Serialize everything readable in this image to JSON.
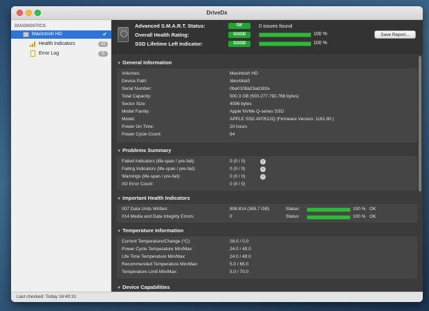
{
  "window": {
    "title": "DriveDx"
  },
  "sidebar": {
    "header": "DIAGNOSTICS",
    "items": [
      {
        "label": "Macintosh HD",
        "icon": "disk-icon",
        "selected": true
      },
      {
        "label": "Health Indicators",
        "icon": "health-bars-icon",
        "badge": "15"
      },
      {
        "label": "Error Log",
        "icon": "log-document-icon",
        "badge": "0"
      }
    ]
  },
  "status_bar": {
    "text": "Last checked: Today 16:40:31"
  },
  "summary": {
    "smart_label": "Advanced S.M.A.R.T. Status:",
    "smart_badge": "OK",
    "smart_text": "0 issues found",
    "health_label": "Overall Health Rating:",
    "health_badge": "GOOD",
    "health_percent": 100,
    "health_percent_text": "100 %",
    "lifetime_label": "SSD Lifetime Left Indicator:",
    "lifetime_badge": "GOOD",
    "lifetime_percent": 100,
    "lifetime_percent_text": "100 %",
    "save_button": "Save Report...",
    "accent_color": "#22c22f"
  },
  "general": {
    "title": "General Information",
    "rows": [
      {
        "k": "Volumes:",
        "v": "Macintosh HD"
      },
      {
        "k": "Device Path:",
        "v": "/dev/disk0"
      },
      {
        "k": "Serial Number:",
        "v": "0ba0108a23ad182e"
      },
      {
        "k": "Total Capacity:",
        "v": "500.3 GB (500.277.792.768 bytes)"
      },
      {
        "k": "Sector Size:",
        "v": "4096 bytes"
      },
      {
        "k": "Model Family:",
        "v": "Apple NVMe Q-series SSD"
      },
      {
        "k": "Model:",
        "v": "APPLE SSD AP0512Q  (Firmware Version: 1161.80.)"
      },
      {
        "k": "Power On Time:",
        "v": "20 hours"
      },
      {
        "k": "Power Cycle Count:",
        "v": "64"
      }
    ]
  },
  "problems": {
    "title": "Problems Summary",
    "rows": [
      {
        "k": "Failed Indicators (life-span / pre-fail):",
        "v": "0 (0 / 0)"
      },
      {
        "k": "Failing Indicators (life-span / pre-fail):",
        "v": "0 (0 / 0)"
      },
      {
        "k": "Warnings (life-span / pre-fail):",
        "v": "0 (0 / 0)"
      },
      {
        "k": "I/O Error Count:",
        "v": "0 (0 / 0)"
      }
    ]
  },
  "health_indicators": {
    "title": "Important Health Indicators",
    "status_label": "Status:",
    "rows": [
      {
        "k": "007  Data Units Written:",
        "v": "808.814 (385.7 GB)",
        "percent": 100,
        "pct_text": "100 %",
        "status": "OK"
      },
      {
        "k": "014  Media and Data Integrity Errors:",
        "v": "0",
        "percent": 100,
        "pct_text": "100 %",
        "status": "OK"
      }
    ]
  },
  "temperature": {
    "title": "Temperature Information",
    "rows": [
      {
        "k": "Current Temperature/Change (°C):",
        "v": "28.0 / 0.0"
      },
      {
        "k": "Power Cycle Temperature Min/Max:",
        "v": "24.0 / 49.0"
      },
      {
        "k": "Life Time Temperature Min/Max:",
        "v": "24.0 / 49.0"
      },
      {
        "k": "Recommended Temperature Min/Max:",
        "v": "5.0   / 65.0"
      },
      {
        "k": "Temperature Limit Min/Max:",
        "v": "5.0   / 70.0"
      }
    ]
  },
  "capabilities": {
    "title": "Device Capabilities"
  }
}
